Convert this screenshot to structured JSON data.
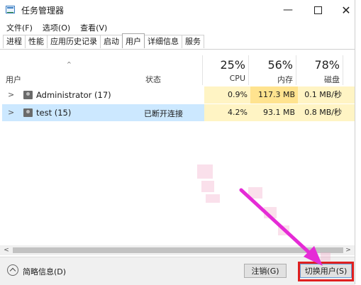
{
  "window": {
    "title": "任务管理器",
    "minimize": "—",
    "close": "✕"
  },
  "menu": [
    "文件(F)",
    "选项(O)",
    "查看(V)"
  ],
  "tabs": [
    "进程",
    "性能",
    "应用历史记录",
    "启动",
    "用户",
    "详细信息",
    "服务"
  ],
  "active_tab": "用户",
  "header": {
    "sort_arrow": "^",
    "user_col": "用户",
    "status_col": "状态",
    "cpu_pct": "25%",
    "cpu_label": "CPU",
    "mem_pct": "56%",
    "mem_label": "内存",
    "disk_pct": "78%",
    "disk_label": "磁盘"
  },
  "rows": [
    {
      "expand": ">",
      "name": "Administrator (17)",
      "status": "",
      "cpu": "0.9%",
      "mem": "117.3 MB",
      "disk": "0.1 MB/秒"
    },
    {
      "expand": ">",
      "name": "test (15)",
      "status": "已断开连接",
      "cpu": "4.2%",
      "mem": "93.1 MB",
      "disk": "0.8 MB/秒"
    }
  ],
  "scroll": {
    "left": "<",
    "right": ">"
  },
  "footer": {
    "fewer_details": "简略信息(D)",
    "logoff_button": "注销(G)",
    "switch_user_button": "切换用户(S)"
  },
  "colors": {
    "selected_row": "#cce8ff",
    "heat_light": "#fff4c4",
    "heat_medium": "#ffe38f",
    "annotation_arrow": "#e52bd6",
    "highlight_box": "#e02020"
  }
}
